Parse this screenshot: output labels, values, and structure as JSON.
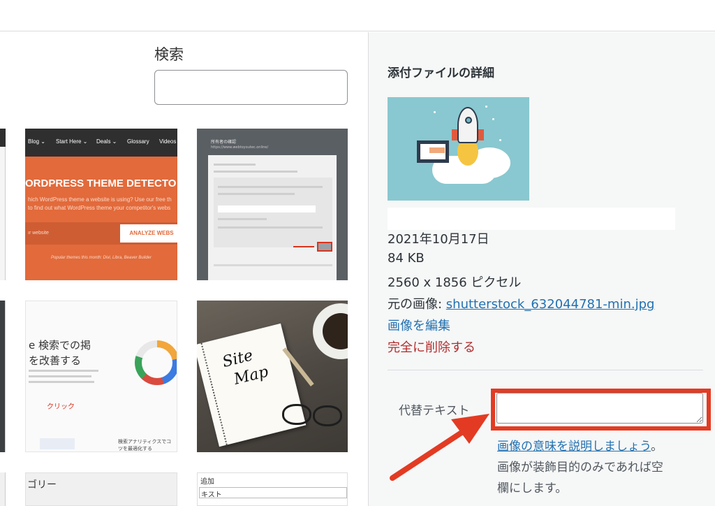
{
  "search": {
    "label": "検索",
    "value": ""
  },
  "thumbnails": {
    "theme_detector": {
      "nav": [
        "Blog ⌄",
        "Start Here ⌄",
        "Deals ⌄",
        "Glossary",
        "Videos"
      ],
      "headline": "ORDPRESS THEME DETECTO",
      "sub1": "hich WordPress theme a website is using? Use our free th",
      "sub2": "to find out what WordPress theme your competitor's webs",
      "field_placeholder": "ır website",
      "button": "ANALYZE WEBS",
      "footer": "Popular themes this month: Divi, Libra, Beaver Builder"
    },
    "console": {
      "heading": "所有者の確認",
      "url": "https://www.webtoyoutec.online/"
    },
    "analytics": {
      "line1": "e 検索での掲",
      "line2": "を改善する",
      "click": "クリック",
      "small1": "検索アナリティクスでコ",
      "small2": "ツを最適化する"
    },
    "sitemap": {
      "word1": "Site",
      "word2": "Map"
    },
    "category": "ゴリー",
    "form_top": "追加",
    "form_field": "キスト"
  },
  "details": {
    "title": "添付ファイルの詳細",
    "date": "2021年10月17日",
    "filesize": "84 KB",
    "dimensions": "2560 x 1856 ピクセル",
    "original_label": "元の画像: ",
    "original_file": "shutterstock_632044781-min.jpg",
    "edit_link": "画像を編集",
    "delete_link": "完全に削除する"
  },
  "alt_text": {
    "label": "代替テキスト",
    "value": "",
    "help_link": "画像の意味を説明しましょう",
    "help_suffix": "。",
    "help_line2": "画像が装飾目的のみであれば空",
    "help_line3": "欄にします。"
  },
  "colors": {
    "annotation_red": "#e33b23",
    "link_blue": "#2271b1",
    "delete_red": "#b32d2e"
  }
}
